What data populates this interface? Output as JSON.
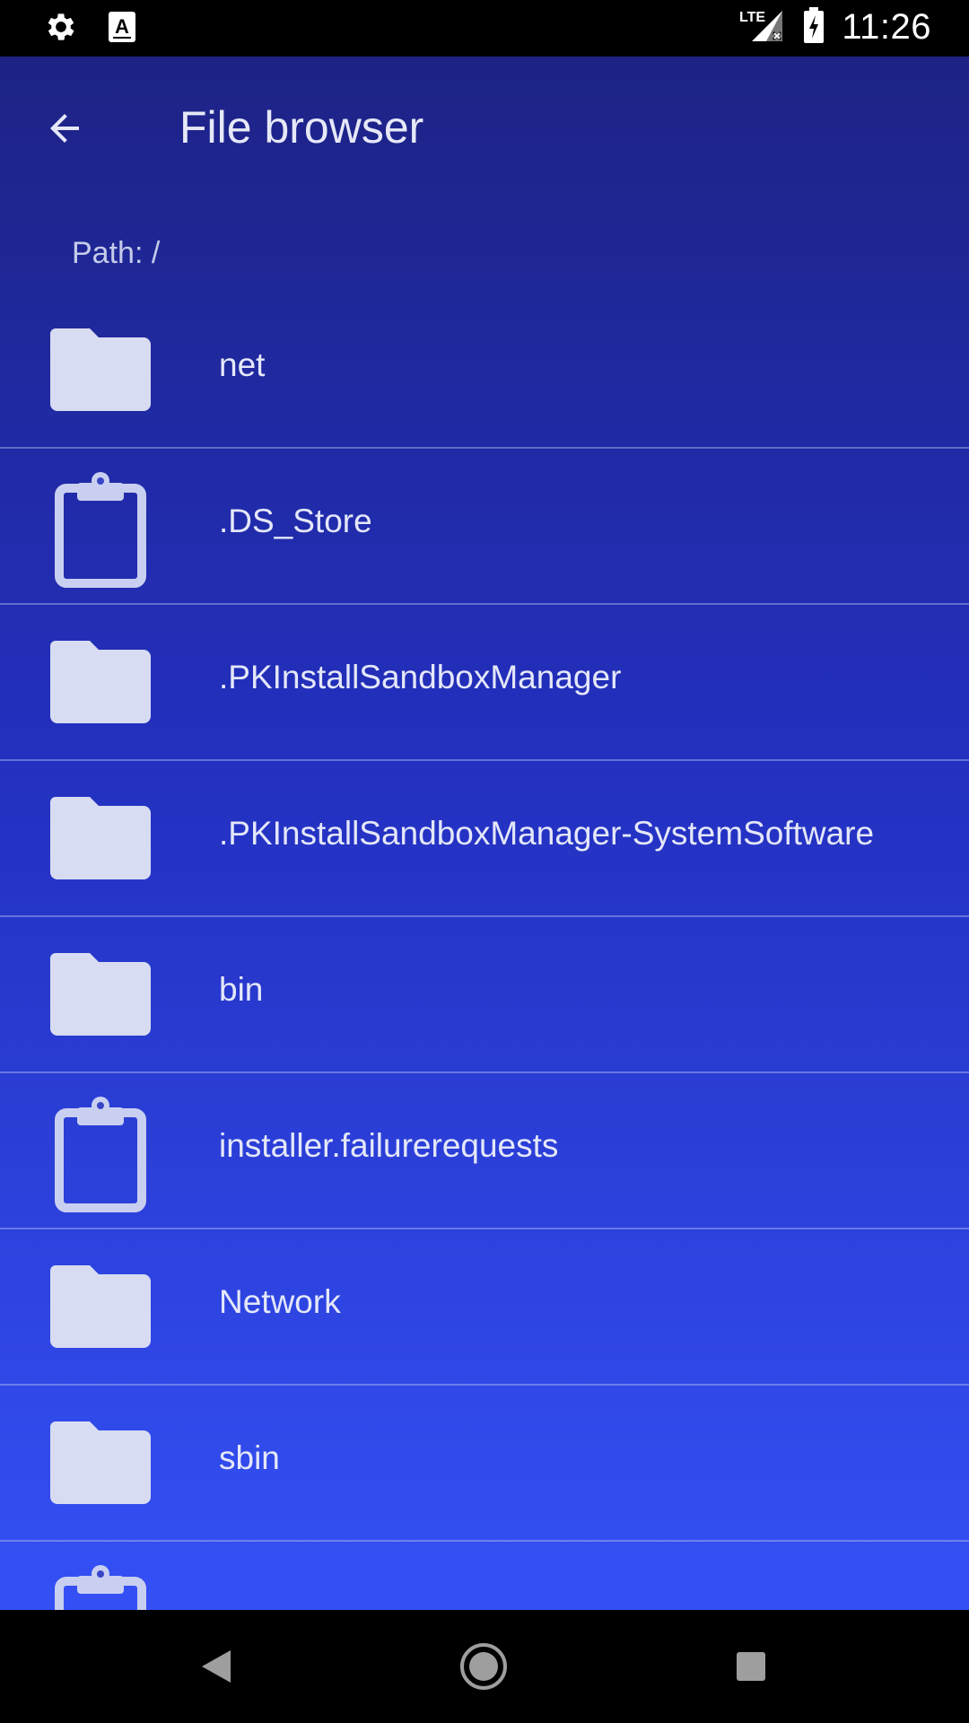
{
  "status_bar": {
    "time": "11:26",
    "left_icons": [
      "settings-icon",
      "keyboard-a-icon"
    ],
    "right_icons": [
      "lte-signal-icon",
      "battery-charging-icon"
    ]
  },
  "app_bar": {
    "title": "File browser",
    "back_icon": "arrow-back-icon"
  },
  "path": {
    "label": "Path: /"
  },
  "files": [
    {
      "name": "net",
      "type": "folder"
    },
    {
      "name": ".DS_Store",
      "type": "file"
    },
    {
      "name": ".PKInstallSandboxManager",
      "type": "folder"
    },
    {
      "name": ".PKInstallSandboxManager-SystemSoftware",
      "type": "folder"
    },
    {
      "name": "bin",
      "type": "folder"
    },
    {
      "name": "installer.failurerequests",
      "type": "file"
    },
    {
      "name": "Network",
      "type": "folder"
    },
    {
      "name": "sbin",
      "type": "folder"
    },
    {
      "name": "",
      "type": "file"
    }
  ],
  "nav_bar": {
    "buttons": [
      "back-triangle-icon",
      "home-circle-icon",
      "recents-square-icon"
    ]
  },
  "colors": {
    "background_top": "#1d2385",
    "background_bottom": "#3450f5",
    "icon_fill": "#d8dcf2",
    "text": "#e4e7f8"
  }
}
